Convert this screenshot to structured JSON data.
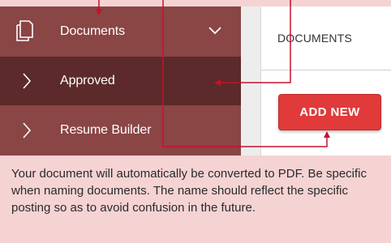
{
  "sidebar": {
    "items": [
      {
        "label": "Documents",
        "icon": "document-copy-icon",
        "expanded": true
      },
      {
        "label": "Approved",
        "icon": "chevron-right-icon",
        "active": true
      },
      {
        "label": "Resume Builder",
        "icon": "chevron-right-icon"
      }
    ]
  },
  "content": {
    "tab_title": "DOCUMENTS",
    "add_button_label": "ADD NEW"
  },
  "note": {
    "text": "Your document will automatically be converted to PDF. Be specific when naming documents. The name should reflect the specific posting so as to avoid confusion in the future."
  },
  "colors": {
    "sidebar_bg": "#8a4545",
    "sidebar_active_bg": "#5c2a2a",
    "accent_red": "#e03a3a",
    "callout_bg": "#f6d3d3",
    "annotation_line": "#c8102e"
  }
}
